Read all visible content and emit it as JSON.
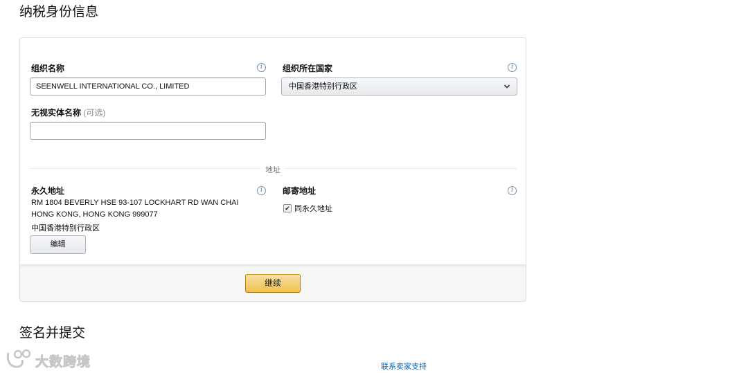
{
  "page_title": "纳税身份信息",
  "org_name": {
    "label": "组织名称",
    "value": "SEENWELL INTERNATIONAL CO., LIMITED"
  },
  "org_country": {
    "label": "组织所在国家",
    "selected": "中国香港特别行政区"
  },
  "disregarded_entity": {
    "label": "无视实体名称",
    "optional_hint": "(可选)",
    "value": ""
  },
  "address_divider": "地址",
  "permanent_address": {
    "label": "永久地址",
    "lines": [
      "RM 1804 BEVERLY HSE 93-107 LOCKHART RD WAN CHAI",
      "HONG KONG, HONG KONG 999077",
      "中国香港特别行政区"
    ],
    "edit_label": "编辑"
  },
  "mailing_address": {
    "label": "邮寄地址",
    "same_as_permanent_label": "同永久地址",
    "same_as_permanent_checked": true
  },
  "continue_label": "继续",
  "section2_title": "签名并提交",
  "support_link": "联系卖家支持",
  "watermark_text": "大数跨境",
  "icons": {
    "info": "info-icon",
    "dropdown": "chevron-down-icon",
    "check": "checkmark-icon",
    "logo": "watermark-logo"
  },
  "colors": {
    "primary_button": "#f0c14b",
    "link": "#0066c0",
    "info_icon": "#4f7fa8"
  }
}
